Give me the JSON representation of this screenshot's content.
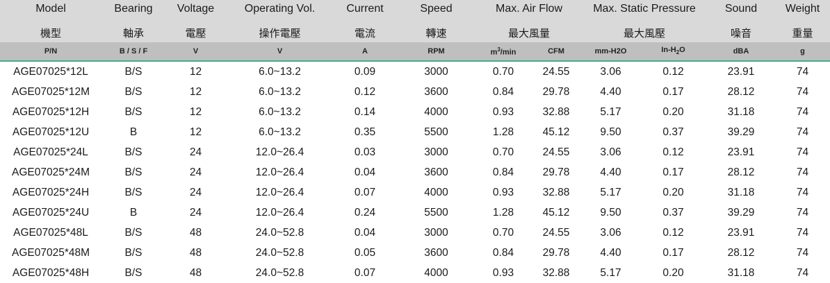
{
  "header": {
    "labels_en": [
      "Model",
      "Bearing",
      "Voltage",
      "Operating Vol.",
      "Current",
      "Speed",
      "Max. Air Flow",
      "Max. Static Pressure",
      "Sound",
      "Weight"
    ],
    "labels_zh": [
      "機型",
      "軸承",
      "電壓",
      "操作電壓",
      "電流",
      "轉速",
      "最大風量",
      "最大風壓",
      "噪音",
      "重量"
    ]
  },
  "units": {
    "pn": "P/N",
    "bearing": "B / S / F",
    "voltage": "V",
    "op_voltage": "V",
    "current": "A",
    "speed": "RPM",
    "airflow_m3_base": "m",
    "airflow_m3_sup": "3",
    "airflow_m3_tail": "/min",
    "airflow_cfm": "CFM",
    "pressure_mmh2o": "mm-H2O",
    "pressure_inh2o_base": "In-H",
    "pressure_inh2o_sub": "2",
    "pressure_inh2o_tail": "O",
    "sound": "dBA",
    "weight": "g"
  },
  "rows": [
    [
      "AGE07025*12L",
      "B/S",
      "12",
      "6.0~13.2",
      "0.09",
      "3000",
      "0.70",
      "24.55",
      "3.06",
      "0.12",
      "23.91",
      "74"
    ],
    [
      "AGE07025*12M",
      "B/S",
      "12",
      "6.0~13.2",
      "0.12",
      "3600",
      "0.84",
      "29.78",
      "4.40",
      "0.17",
      "28.12",
      "74"
    ],
    [
      "AGE07025*12H",
      "B/S",
      "12",
      "6.0~13.2",
      "0.14",
      "4000",
      "0.93",
      "32.88",
      "5.17",
      "0.20",
      "31.18",
      "74"
    ],
    [
      "AGE07025*12U",
      "B",
      "12",
      "6.0~13.2",
      "0.35",
      "5500",
      "1.28",
      "45.12",
      "9.50",
      "0.37",
      "39.29",
      "74"
    ],
    [
      "AGE07025*24L",
      "B/S",
      "24",
      "12.0~26.4",
      "0.03",
      "3000",
      "0.70",
      "24.55",
      "3.06",
      "0.12",
      "23.91",
      "74"
    ],
    [
      "AGE07025*24M",
      "B/S",
      "24",
      "12.0~26.4",
      "0.04",
      "3600",
      "0.84",
      "29.78",
      "4.40",
      "0.17",
      "28.12",
      "74"
    ],
    [
      "AGE07025*24H",
      "B/S",
      "24",
      "12.0~26.4",
      "0.07",
      "4000",
      "0.93",
      "32.88",
      "5.17",
      "0.20",
      "31.18",
      "74"
    ],
    [
      "AGE07025*24U",
      "B",
      "24",
      "12.0~26.4",
      "0.24",
      "5500",
      "1.28",
      "45.12",
      "9.50",
      "0.37",
      "39.29",
      "74"
    ],
    [
      "AGE07025*48L",
      "B/S",
      "48",
      "24.0~52.8",
      "0.04",
      "3000",
      "0.70",
      "24.55",
      "3.06",
      "0.12",
      "23.91",
      "74"
    ],
    [
      "AGE07025*48M",
      "B/S",
      "48",
      "24.0~52.8",
      "0.05",
      "3600",
      "0.84",
      "29.78",
      "4.40",
      "0.17",
      "28.12",
      "74"
    ],
    [
      "AGE07025*48H",
      "B/S",
      "48",
      "24.0~52.8",
      "0.07",
      "4000",
      "0.93",
      "32.88",
      "5.17",
      "0.20",
      "31.18",
      "74"
    ]
  ]
}
